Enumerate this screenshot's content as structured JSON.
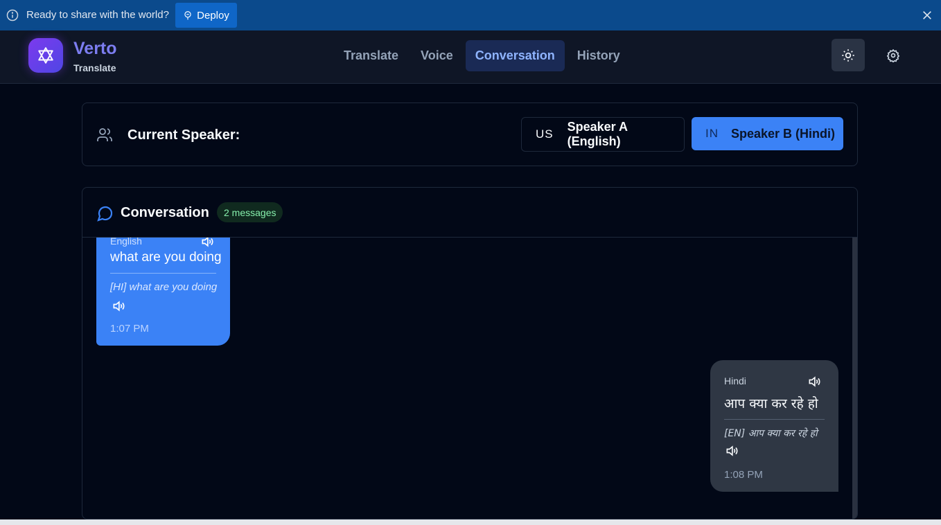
{
  "banner": {
    "message": "Ready to share with the world?",
    "deploy_label": "Deploy"
  },
  "header": {
    "brand_name": "Verto",
    "brand_sub": "Translate",
    "tabs": [
      {
        "label": "Translate"
      },
      {
        "label": "Voice"
      },
      {
        "label": "Conversation",
        "active": true
      },
      {
        "label": "History"
      }
    ]
  },
  "speaker_card": {
    "label": "Current Speaker:",
    "speaker_a": {
      "flag": "US",
      "label": "Speaker A (English)"
    },
    "speaker_b": {
      "flag": "IN",
      "label": "Speaker B (Hindi)",
      "selected": true
    }
  },
  "conversation": {
    "title": "Conversation",
    "count_badge": "2 messages",
    "messages": [
      {
        "speaker": "A",
        "language": "English",
        "original": "what are you doing",
        "translated": "[HI] what are you doing",
        "time": "1:07 PM"
      },
      {
        "speaker": "B",
        "language": "Hindi",
        "original": "आप क्या कर रहे हो",
        "translated": "[EN] आप क्या कर रहे हो",
        "time": "1:08 PM"
      }
    ]
  },
  "colors": {
    "accent_blue": "#3b82f6",
    "banner_bg": "#0b4a8c",
    "page_bg": "#020817",
    "brand_purple": "#7c3aed"
  },
  "icons": [
    "info-icon",
    "deploy-icon",
    "close-icon",
    "star-of-david-logo-icon",
    "sun-icon",
    "gear-icon",
    "users-icon",
    "chat-bubble-icon",
    "speaker-volume-icon"
  ]
}
